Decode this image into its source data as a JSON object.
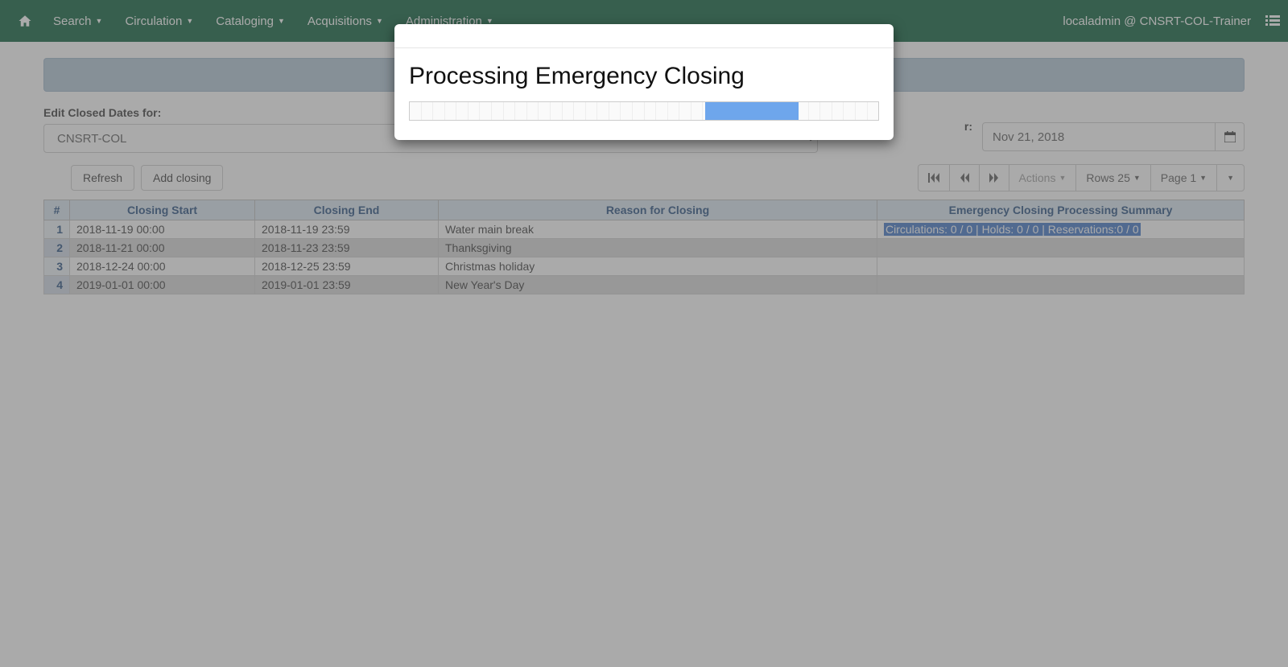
{
  "nav": {
    "items": [
      "Search",
      "Circulation",
      "Cataloging",
      "Acquisitions",
      "Administration"
    ],
    "user": "localadmin @ CNSRT-COL-Trainer"
  },
  "form": {
    "edit_label": "Edit Closed Dates for:",
    "library": "CNSRT-COL",
    "date_partial_label": "r:",
    "date_value": "Nov 21, 2018"
  },
  "toolbar": {
    "refresh": "Refresh",
    "add_closing": "Add closing",
    "actions": "Actions",
    "rows": "Rows 25",
    "page": "Page 1"
  },
  "table": {
    "headers": [
      "#",
      "Closing Start",
      "Closing End",
      "Reason for Closing",
      "Emergency Closing Processing Summary"
    ],
    "rows": [
      {
        "n": "1",
        "start": "2018-11-19 00:00",
        "end": "2018-11-19 23:59",
        "reason": "Water main break",
        "summary": "Circulations: 0 / 0 | Holds: 0 / 0 | Reservations:0 / 0"
      },
      {
        "n": "2",
        "start": "2018-11-21 00:00",
        "end": "2018-11-23 23:59",
        "reason": "Thanksgiving",
        "summary": ""
      },
      {
        "n": "3",
        "start": "2018-12-24 00:00",
        "end": "2018-12-25 23:59",
        "reason": "Christmas holiday",
        "summary": ""
      },
      {
        "n": "4",
        "start": "2019-01-01 00:00",
        "end": "2019-01-01 23:59",
        "reason": "New Year's Day",
        "summary": ""
      }
    ]
  },
  "modal": {
    "title": "Processing Emergency Closing"
  }
}
